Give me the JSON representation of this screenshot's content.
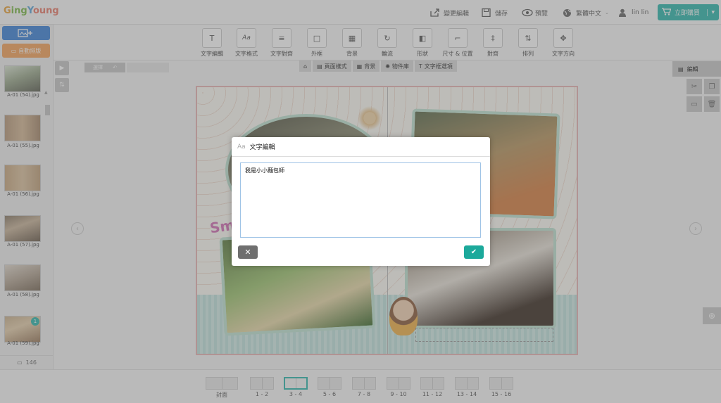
{
  "app": {
    "logo": "GingYoung"
  },
  "topbar": {
    "links": [
      {
        "label": "變更編輯",
        "icon": "share-icon"
      },
      {
        "label": "儲存",
        "icon": "save-icon"
      },
      {
        "label": "預覽",
        "icon": "eye-icon"
      },
      {
        "label": "繁體中文",
        "icon": "globe-icon"
      },
      {
        "label": "lin lin",
        "icon": "user-icon"
      }
    ],
    "buy_label": "立即購買"
  },
  "left_panel": {
    "auto_layout_label": "自動排版",
    "thumbnails": [
      "A-01 (54).jpg",
      "A-01 (55).jpg",
      "A-01 (56).jpg",
      "A-01 (57).jpg",
      "A-01 (58).jpg",
      "A-01 (59).jpg"
    ],
    "badge": "1",
    "photo_count": "146"
  },
  "toolbar": {
    "tools": [
      {
        "label": "文字編輯",
        "icon": "text-edit-icon",
        "glyph": "T"
      },
      {
        "label": "文字格式",
        "icon": "text-format-icon",
        "glyph": "Aa"
      },
      {
        "label": "文字對齊",
        "icon": "text-align-icon",
        "glyph": "≡"
      },
      {
        "label": "外框",
        "icon": "frame-icon",
        "glyph": "□"
      },
      {
        "label": "背景",
        "icon": "background-icon",
        "glyph": "▦"
      },
      {
        "label": "輪流",
        "icon": "rotate-icon",
        "glyph": "↻"
      },
      {
        "label": "形狀",
        "icon": "shape-icon",
        "glyph": "◧"
      },
      {
        "label": "尺寸 & 位置",
        "icon": "size-position-icon",
        "glyph": "⌐"
      },
      {
        "label": "對齊",
        "icon": "align-icon",
        "glyph": "‡"
      },
      {
        "label": "排列",
        "icon": "arrange-icon",
        "glyph": "⇅"
      },
      {
        "label": "文字方向",
        "icon": "text-direction-icon",
        "glyph": "✥"
      }
    ]
  },
  "subtabs": [
    {
      "label": "",
      "icon": "home-icon"
    },
    {
      "label": "頁面樣式",
      "icon": "page-style-icon"
    },
    {
      "label": "背景",
      "icon": "background-icon"
    },
    {
      "label": "物件庫",
      "icon": "object-library-icon"
    },
    {
      "label": "文字框選項",
      "icon": "textbox-options-icon"
    }
  ],
  "undo": {
    "label": "選擇"
  },
  "right_panel": {
    "edit_label": "編輯"
  },
  "pages": [
    "封面",
    "1 - 2",
    "3 - 4",
    "5 - 6",
    "7 - 8",
    "9 - 10",
    "11 - 12",
    "13 - 14",
    "15 - 16"
  ],
  "active_page": "3 - 4",
  "dialog": {
    "icon": "Aa",
    "title": "文字編輯",
    "text": "我是小小麵包師",
    "cancel_glyph": "✕",
    "ok_glyph": "✔"
  },
  "colors": {
    "accent": "#2eb7ac",
    "blue_button": "#3b82d8",
    "orange_button": "#f5a35b"
  }
}
